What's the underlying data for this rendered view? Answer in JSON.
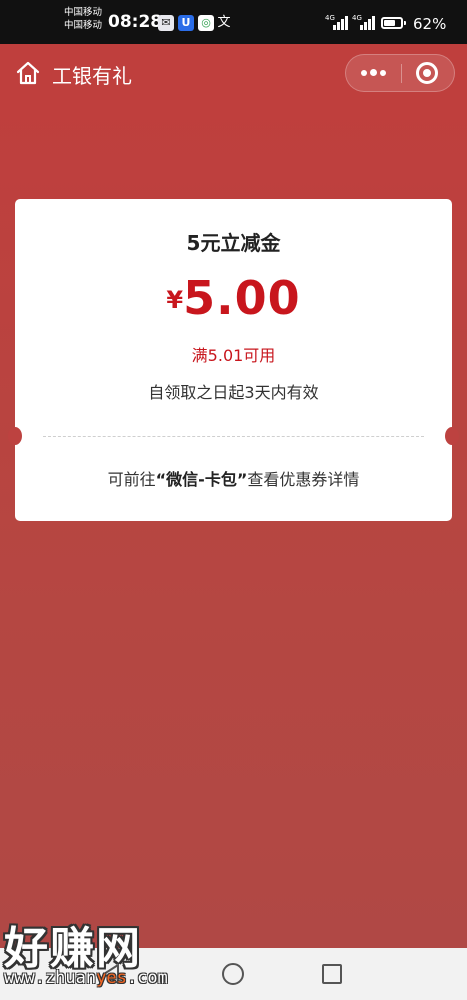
{
  "status_bar": {
    "carrier_1": "中国移动",
    "carrier_2": "中国移动",
    "time": "08:28",
    "network_1": "4G",
    "network_2": "4G",
    "battery": "62%",
    "app_icons": [
      "mail-icon",
      "app-u-icon",
      "app-green-icon",
      "translate-icon"
    ]
  },
  "nav": {
    "title": "工银有礼",
    "home_icon": "home-icon",
    "more_icon": "more-dots-icon",
    "close_icon": "close-target-icon"
  },
  "coupon": {
    "title": "5元立减金",
    "currency": "¥",
    "amount": "5.00",
    "condition": "满5.01可用",
    "validity": "自领取之日起3天内有效",
    "footer_prefix": "可前往",
    "footer_highlight": "“微信-卡包”",
    "footer_suffix": "查看优惠券详情"
  },
  "watermark": {
    "big": "好赚网",
    "url_prefix": "www.zhuan",
    "url_highlight": "yes",
    "url_suffix": ".com"
  },
  "colors": {
    "accent_red": "#c8161d",
    "navbar_bg": "#bf3f3d",
    "page_bg": "#b24743"
  }
}
